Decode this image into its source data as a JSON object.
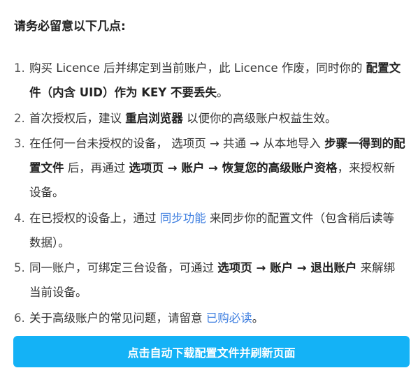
{
  "notice": {
    "heading": "请务必留意以下几点:",
    "items": [
      {
        "num": "1.",
        "t1": "购买 Licence 后并绑定到当前账户，此 Licence 作废，同时你的 ",
        "b1": "配置文件（内含 UID）作为 KEY 不要丢失",
        "t2": "。"
      },
      {
        "num": "2.",
        "t1": "首次授权后，建议 ",
        "b1": "重启浏览器",
        "t2": " 以便你的高级账户权益生效。"
      },
      {
        "num": "3.",
        "t1": "在任何一台未授权的设备， 选项页 → 共通 → 从本地导入 ",
        "b1": "步骤一得到的配置文件",
        "t2": " 后，再通过 ",
        "b2": "选项页 → 账户 → 恢复您的高级账户资格",
        "t3": "，来授权新设备。"
      },
      {
        "num": "4.",
        "t1": "在已授权的设备上，通过 ",
        "link": "同步功能",
        "t2": " 来同步你的配置文件（包含稍后读等数据）。"
      },
      {
        "num": "5.",
        "t1": "同一账户，可绑定三台设备，可通过 ",
        "b1": "选项页 → 账户 → 退出账户",
        "t2": " 来解绑当前设备。"
      },
      {
        "num": "6.",
        "t1": "关于高级账户的常见问题，请留意 ",
        "link": "已购必读",
        "t2": "。"
      }
    ]
  },
  "action_button": {
    "label": "点击自动下载配置文件并刷新页面"
  },
  "colors": {
    "button_bg": "#14b2f6",
    "link": "#3f7fe0",
    "text": "#333333"
  }
}
